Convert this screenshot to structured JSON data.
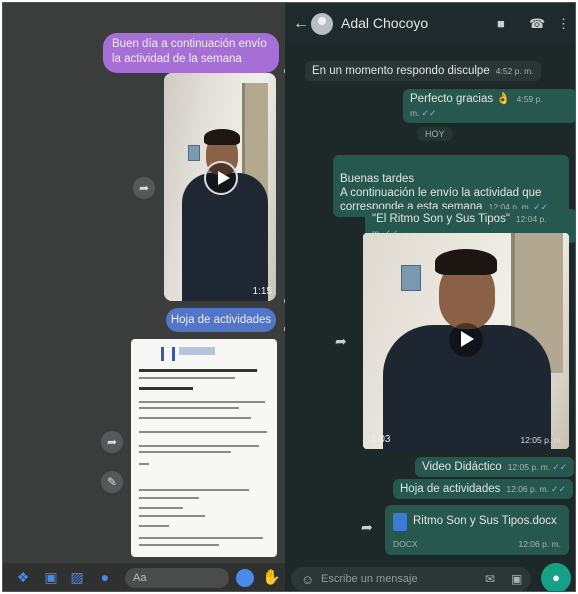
{
  "left": {
    "messages": {
      "purple": "Buen día a continuación envío la actividad de la semana",
      "blue": "Hoja de actividades",
      "video_time": "1:15"
    },
    "input_placeholder": "Aa",
    "icons": {
      "share": "share-icon",
      "pen": "pen-icon",
      "apps": "apps-icon",
      "camera": "camera-icon",
      "image": "image-icon",
      "mic": "mic-icon",
      "emoji": "emoji-icon",
      "like": "like-icon"
    }
  },
  "right": {
    "contact_name": "Adal Chocoyo",
    "messages": [
      {
        "type": "in",
        "text": "En un momento respondo disculpe",
        "time": "4:52 p. m."
      },
      {
        "type": "out",
        "text": "Perfecto gracias 👌",
        "time": "4:59 p. m."
      },
      {
        "type": "out",
        "text": "Buenas tardes\nA continuación le envío la actividad que corresponde a esta semana",
        "time": "12:04 p. m."
      },
      {
        "type": "out",
        "text": "\"El Ritmo Son y Sus Tipos\"",
        "time": "12:04 p. m."
      },
      {
        "type": "out",
        "text": "Video Didáctico",
        "time": "12:05 p. m."
      },
      {
        "type": "out",
        "text": "Hoja de actividades",
        "time": "12:06 p. m."
      }
    ],
    "day_divider": "HOY",
    "video_duration": "1:03",
    "video_time": "12:05 p. m.",
    "document": {
      "name": "Ritmo Son y Sus Tipos.docx",
      "ext": "DOCX",
      "time": "12:06 p. m."
    },
    "input_placeholder": "Escribe un mensaje",
    "colors": {
      "accent": "#16a085",
      "outgoing": "#27584e",
      "incoming": "#2a3535"
    }
  }
}
